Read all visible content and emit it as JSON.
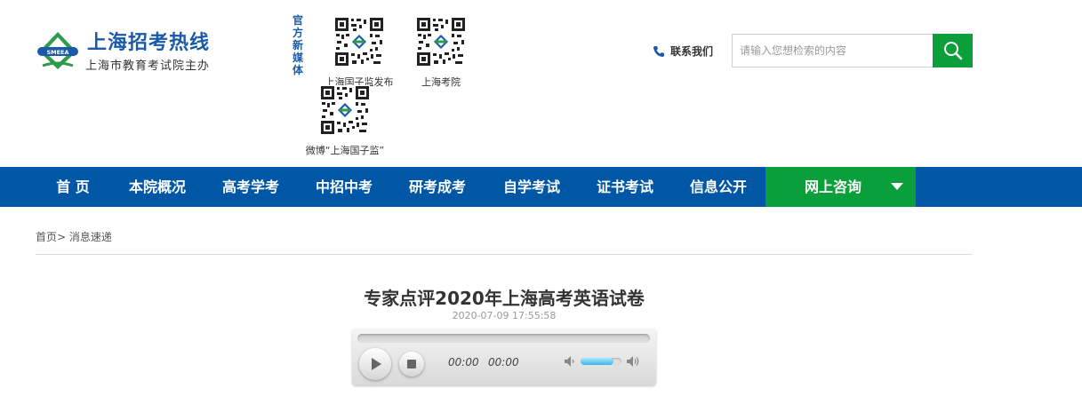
{
  "header": {
    "logo_title": "上海招考热线",
    "logo_subtitle": "上海市教育考试院主办",
    "logo_emblem_text": "SMEEA",
    "media_label": "官方新媒体",
    "qr_codes": [
      {
        "caption": "上海国子监发布"
      },
      {
        "caption": "上海考院"
      },
      {
        "caption": "微博“上海国子监”"
      }
    ],
    "contact_label": "联系我们",
    "search_placeholder": "请输入您想检索的内容",
    "icons": {
      "phone": "phone-icon",
      "search": "search-icon"
    }
  },
  "nav": {
    "items": [
      {
        "label": "首 页"
      },
      {
        "label": "本院概况"
      },
      {
        "label": "高考学考"
      },
      {
        "label": "中招中考"
      },
      {
        "label": "研考成考"
      },
      {
        "label": "自学考试"
      },
      {
        "label": "证书考试"
      },
      {
        "label": "信息公开"
      }
    ],
    "consult_label": "网上咨询"
  },
  "breadcrumb": {
    "home": "首页",
    "separator": ">",
    "current": "消息速递"
  },
  "article": {
    "title": "专家点评2020年上海高考英语试卷",
    "date": "2020-07-09 17:55:58"
  },
  "player": {
    "current_time": "00:00",
    "duration": "00:00",
    "progress": 0,
    "volume": 0.8
  },
  "colors": {
    "nav_blue": "#0057a6",
    "accent_green": "#0a9f3b",
    "logo_blue": "#1a5aa8"
  }
}
